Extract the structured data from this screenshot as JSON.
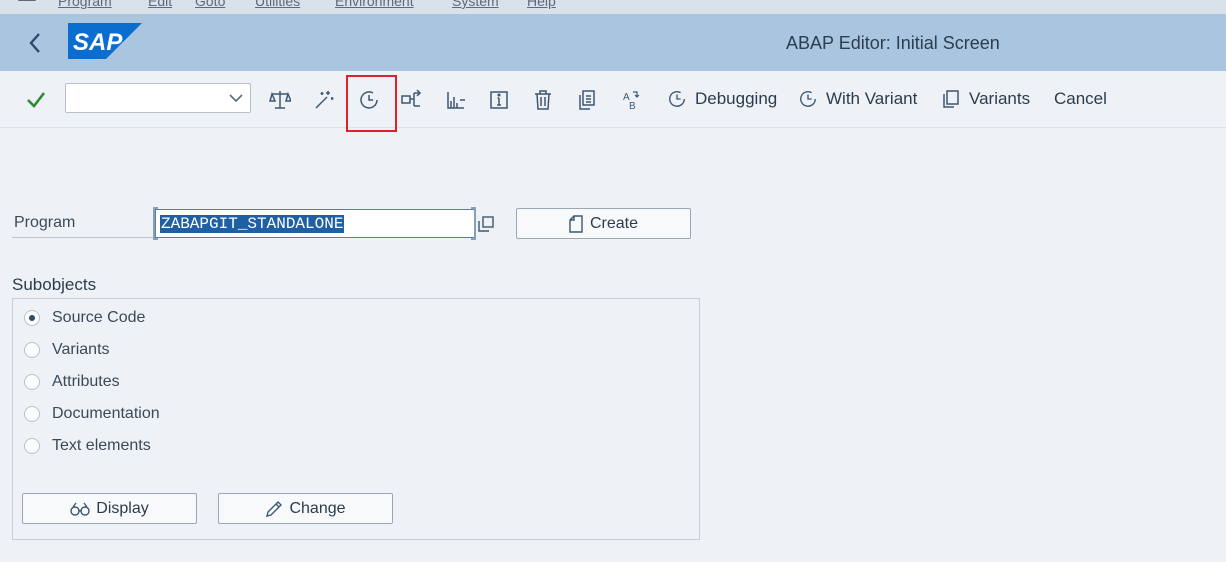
{
  "menubar": {
    "items": [
      "Program",
      "Edit",
      "Goto",
      "Utilities",
      "Environment",
      "System",
      "Help"
    ]
  },
  "header": {
    "title": "ABAP Editor: Initial Screen",
    "logo_text": "SAP",
    "brand_color": "#0a6ed1"
  },
  "toolbar": {
    "combo_value": "",
    "icons": [
      "check-icon",
      "balance-scale-icon",
      "magic-wand-icon",
      "clock-run-icon",
      "where-used-icon",
      "hierarchy-icon",
      "info-icon",
      "delete-icon",
      "copy-icon",
      "rename-icon"
    ],
    "debugging_label": "Debugging",
    "with_variant_label": "With Variant",
    "variants_label": "Variants",
    "cancel_label": "Cancel",
    "highlight_color": "#d8242c"
  },
  "program": {
    "label": "Program",
    "value": "ZABAPGIT_STANDALONE",
    "create_label": "Create"
  },
  "subobjects": {
    "label": "Subobjects",
    "options": [
      "Source Code",
      "Variants",
      "Attributes",
      "Documentation",
      "Text elements"
    ],
    "selected": "Source Code",
    "display_label": "Display",
    "change_label": "Change"
  }
}
